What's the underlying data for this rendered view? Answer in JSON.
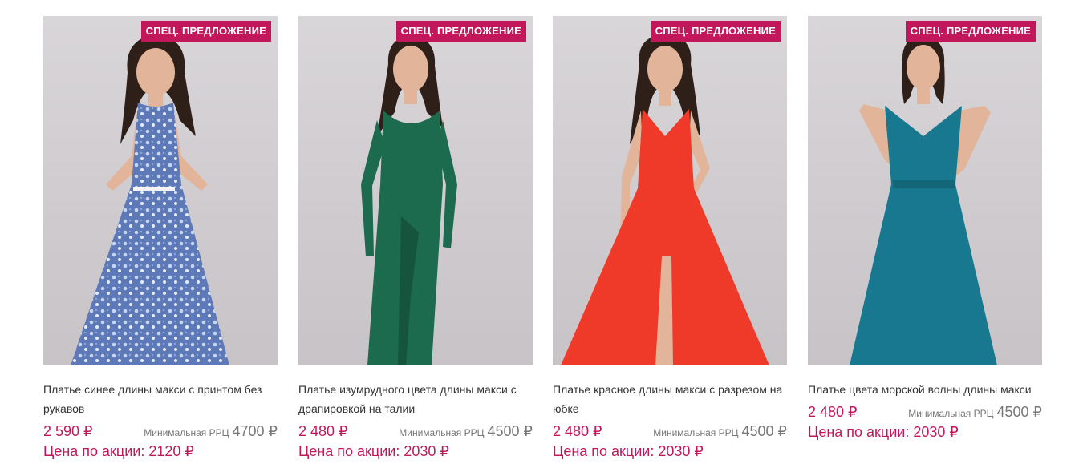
{
  "colors": {
    "accent": "#c2185b",
    "muted": "#777777"
  },
  "currency": "₽",
  "products": [
    {
      "badge": "СПЕЦ. ПРЕДЛОЖЕНИЕ",
      "title": "Платье синее длины макси с принтом без рукавов",
      "price": "2 590 ₽",
      "rrp_label": "Минимальная РРЦ",
      "rrp_value": "4700 ₽",
      "promo": "Цена по акции: 2120 ₽",
      "dress_color": "#5d79b7",
      "dress_pattern": "floral"
    },
    {
      "badge": "СПЕЦ. ПРЕДЛОЖЕНИЕ",
      "title": "Платье изумрудного цвета длины макси с драпировкой на талии",
      "price": "2 480 ₽",
      "rrp_label": "Минимальная РРЦ",
      "rrp_value": "4500 ₽",
      "promo": "Цена по акции: 2030 ₽",
      "dress_color": "#1c6b4e",
      "dress_pattern": "solid"
    },
    {
      "badge": "СПЕЦ. ПРЕДЛОЖЕНИЕ",
      "title": "Платье красное длины макси с разрезом на юбке",
      "price": "2 480 ₽",
      "rrp_label": "Минимальная РРЦ",
      "rrp_value": "4500 ₽",
      "promo": "Цена по акции: 2030 ₽",
      "dress_color": "#ef3a2a",
      "dress_pattern": "solid"
    },
    {
      "badge": "СПЕЦ. ПРЕДЛОЖЕНИЕ",
      "title": "Платье цвета морской волны длины макси",
      "price": "2 480 ₽",
      "rrp_label": "Минимальная РРЦ",
      "rrp_value": "4500 ₽",
      "promo": "Цена по акции: 2030 ₽",
      "dress_color": "#18788f",
      "dress_pattern": "solid"
    }
  ]
}
